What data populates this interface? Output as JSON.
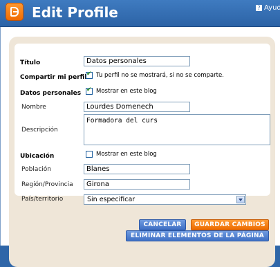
{
  "header": {
    "title": "Edit Profile",
    "help_label": "Ayuda"
  },
  "form": {
    "titulo": {
      "label": "Título",
      "value": "Datos personales"
    },
    "compartir": {
      "label": "Compartir mi perfil",
      "checked": true,
      "text": "Tu perfil no se mostrará, si no se comparte."
    },
    "datos": {
      "label": "Datos personales",
      "checked": true,
      "text": "Mostrar en este blog"
    },
    "nombre": {
      "label": "Nombre",
      "value": "Lourdes Domenech"
    },
    "descripcion": {
      "label": "Descripción",
      "value": "Formadora del curs"
    },
    "ubicacion": {
      "label": "Ubicación",
      "checked": false,
      "text": "Mostrar en este blog"
    },
    "poblacion": {
      "label": "Población",
      "value": "Blanes"
    },
    "region": {
      "label": "Región/Provincia",
      "value": "Girona"
    },
    "pais": {
      "label": "País/territorio",
      "value": "Sin especificar"
    }
  },
  "buttons": {
    "cancel": "CANCELAR",
    "save": "GUARDAR CAMBIOS",
    "delete": "ELIMINAR ELEMENTOS DE LA PÁGINA"
  },
  "colors": {
    "header_blue": "#2c63a6",
    "brand_orange": "#f06a00",
    "card_beige": "#efe6d8"
  }
}
